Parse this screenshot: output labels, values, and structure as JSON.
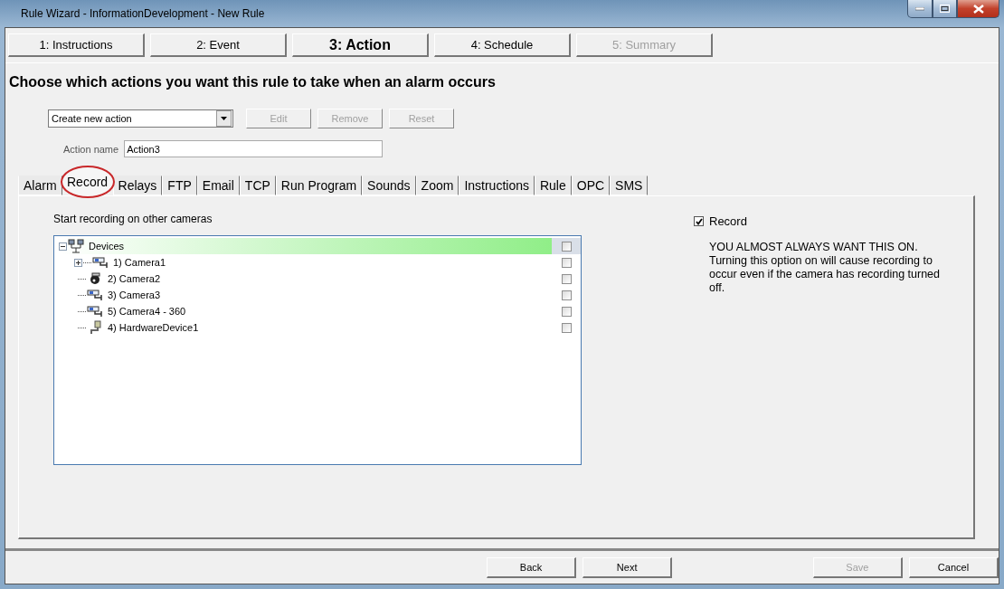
{
  "window": {
    "title": "Rule Wizard - InformationDevelopment - New Rule"
  },
  "steps": [
    {
      "label": "1: Instructions",
      "selected": false,
      "disabled": false
    },
    {
      "label": "2: Event",
      "selected": false,
      "disabled": false
    },
    {
      "label": "3: Action",
      "selected": true,
      "disabled": false
    },
    {
      "label": "4: Schedule",
      "selected": false,
      "disabled": false
    },
    {
      "label": "5: Summary",
      "selected": false,
      "disabled": true
    }
  ],
  "heading": "Choose which actions you want this rule to take when an alarm occurs",
  "action_select": {
    "value": "Create new action"
  },
  "action_buttons": [
    {
      "label": "Edit",
      "disabled": true
    },
    {
      "label": "Remove",
      "disabled": true
    },
    {
      "label": "Reset",
      "disabled": true
    }
  ],
  "action_name": {
    "label": "Action name",
    "value": "Action3"
  },
  "tabs": [
    {
      "label": "Alarm",
      "selected": false,
      "circled": false
    },
    {
      "label": "Record",
      "selected": true,
      "circled": true
    },
    {
      "label": "Relays",
      "selected": false,
      "circled": false
    },
    {
      "label": "FTP",
      "selected": false,
      "circled": false
    },
    {
      "label": "Email",
      "selected": false,
      "circled": false
    },
    {
      "label": "TCP",
      "selected": false,
      "circled": false
    },
    {
      "label": "Run Program",
      "selected": false,
      "circled": false
    },
    {
      "label": "Sounds",
      "selected": false,
      "circled": false
    },
    {
      "label": "Zoom",
      "selected": false,
      "circled": false
    },
    {
      "label": "Instructions",
      "selected": false,
      "circled": false
    },
    {
      "label": "Rule",
      "selected": false,
      "circled": false
    },
    {
      "label": "OPC",
      "selected": false,
      "circled": false
    },
    {
      "label": "SMS",
      "selected": false,
      "circled": false
    }
  ],
  "record": {
    "caption": "Start recording on other cameras",
    "tree": [
      {
        "label": "Devices",
        "kind": "network",
        "expanded": true,
        "checked": false,
        "selected": true,
        "children": [
          {
            "label": "1) Camera1",
            "kind": "camera",
            "expanded": false,
            "checked": false,
            "selected": false
          },
          {
            "label": "2) Camera2",
            "kind": "dome",
            "checked": false,
            "selected": false
          },
          {
            "label": "3) Camera3",
            "kind": "camera",
            "checked": false,
            "selected": false
          },
          {
            "label": "5) Camera4 - 360",
            "kind": "camera",
            "checked": false,
            "selected": false
          },
          {
            "label": "4) HardwareDevice1",
            "kind": "hardware",
            "checked": false,
            "selected": false
          }
        ]
      }
    ],
    "option": {
      "label": "Record",
      "checked": true
    },
    "note_title": "YOU ALMOST ALWAYS WANT THIS ON.",
    "note": "Turning this option on will cause recording to occur even if the camera has recording turned off."
  },
  "footer_buttons": [
    {
      "label": "Back",
      "disabled": false
    },
    {
      "label": "Next",
      "disabled": false
    },
    {
      "label": "Save",
      "disabled": true
    },
    {
      "label": "Cancel",
      "disabled": false
    }
  ]
}
